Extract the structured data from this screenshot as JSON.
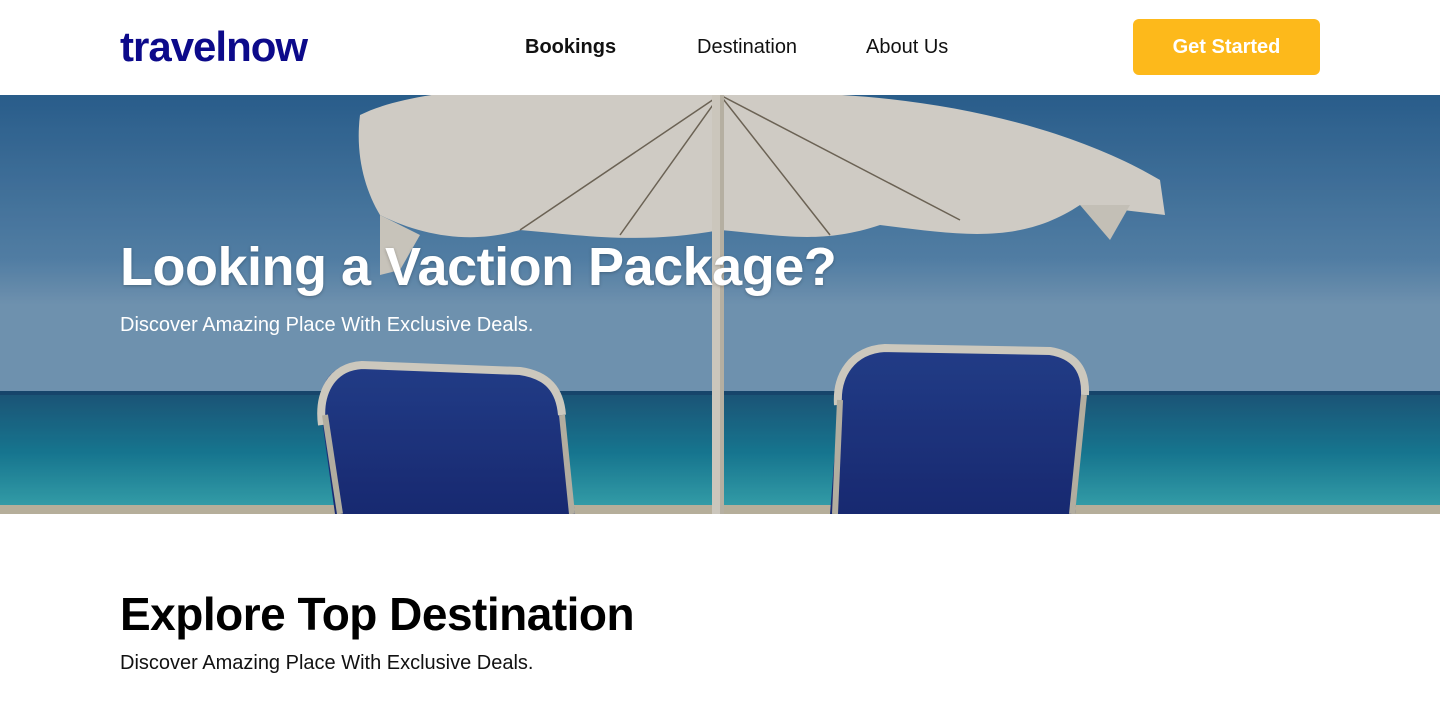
{
  "header": {
    "logo": "travelnow",
    "nav": [
      {
        "label": "Bookings",
        "active": true
      },
      {
        "label": "Destination",
        "active": false
      },
      {
        "label": "About Us",
        "active": false
      }
    ],
    "cta_label": "Get Started"
  },
  "hero": {
    "title": "Looking a Vaction Package?",
    "subtitle": "Discover Amazing Place With Exclusive Deals."
  },
  "section": {
    "title": "Explore Top Destination",
    "subtitle": "Discover Amazing Place With Exclusive Deals."
  },
  "colors": {
    "brand": "#0c0a8a",
    "accent": "#fdb91b"
  }
}
